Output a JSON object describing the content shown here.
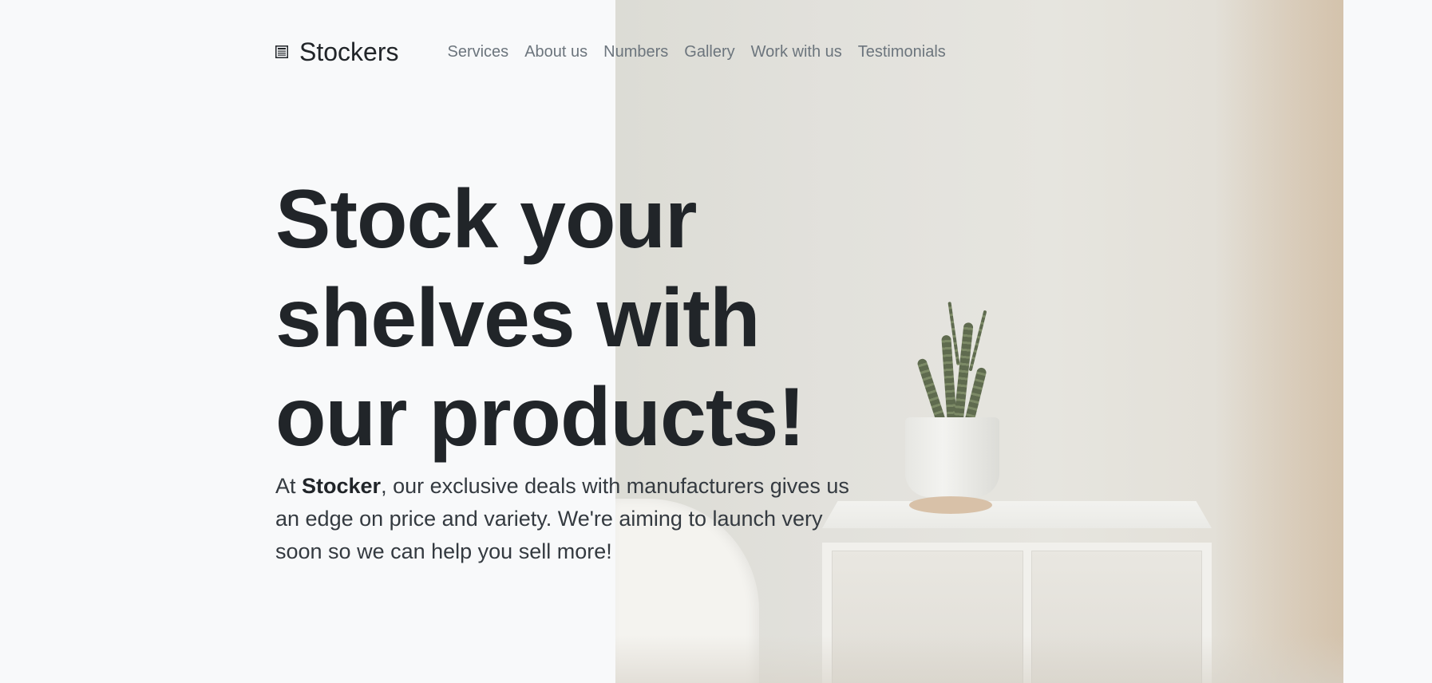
{
  "colors": {
    "page_background": "#f8f9fa",
    "heading_text": "#212529",
    "nav_text": "#6c757d",
    "body_text": "#343a40"
  },
  "navbar": {
    "brand_icon": "newspaper-icon",
    "brand_name": "Stockers",
    "links": [
      {
        "label": "Services"
      },
      {
        "label": "About us"
      },
      {
        "label": "Numbers"
      },
      {
        "label": "Gallery"
      },
      {
        "label": "Work with us"
      },
      {
        "label": "Testimonials"
      }
    ]
  },
  "hero": {
    "heading": "Stock your shelves with our products!",
    "lead_prefix": "At ",
    "lead_brand": "Stocker",
    "lead_suffix": ", our exclusive deals with manufacturers gives us an edge on price and variety. We're aiming to launch very soon so we can help you sell more!"
  }
}
